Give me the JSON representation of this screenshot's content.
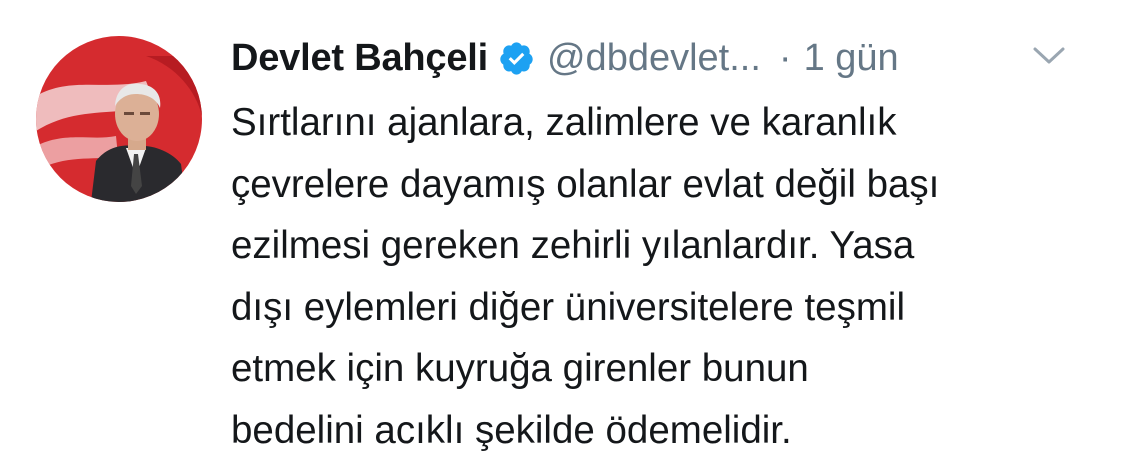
{
  "tweet": {
    "author": {
      "display_name": "Devlet Bahçeli",
      "handle": "@dbdevlet...",
      "verified": true,
      "avatar_icon": "profile-photo-with-flag-background"
    },
    "separator": "·",
    "timestamp": "1 gün",
    "menu_icon": "chevron-down-icon",
    "text_lines": [
      "Sırtlarını ajanlara, zalimlere ve karanlık",
      "çevrelere dayamış olanlar evlat değil başı",
      "ezilmesi gereken zehirli yılanlardır. Yasa",
      "dışı eylemleri diğer üniversitelere teşmil",
      "etmek için kuyruğa girenler bunun",
      "bedelini acıklı şekilde ödemelidir."
    ]
  },
  "colors": {
    "text_primary": "#14171a",
    "text_secondary": "#657786",
    "verified_blue": "#1da1f2",
    "flag_red": "#d32027"
  }
}
